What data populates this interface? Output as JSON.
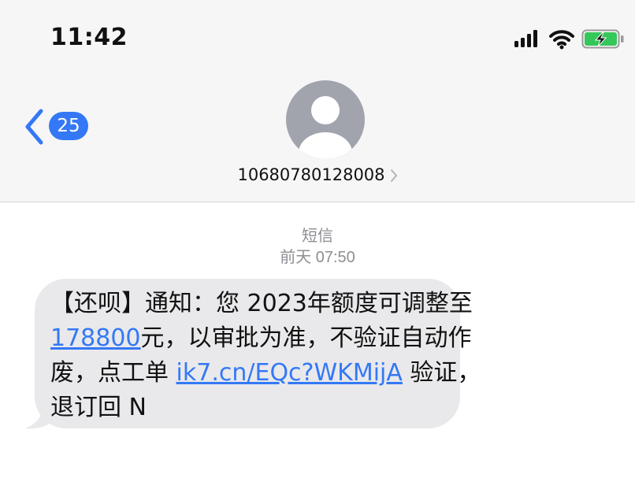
{
  "status_bar": {
    "time": "11:42"
  },
  "nav": {
    "unread_count": "25",
    "contact_name": "10680780128008"
  },
  "thread": {
    "channel_label": "短信",
    "timestamp": "前天 07:50"
  },
  "message": {
    "seg1": "【还呗】通知：您 2023年额度可调整至",
    "amount_link": "178800",
    "seg2": "元，以审批为准，不验证自动作废，点工单 ",
    "url_link": "ik7.cn/EQc?WKMijA",
    "seg3": " 验证，退订回 N"
  },
  "colors": {
    "accent": "#3478f6",
    "bubble": "#e9e9eb",
    "battery": "#34c759"
  },
  "icons": [
    "signal-icon",
    "wifi-icon",
    "battery-charging-icon",
    "back-chevron-icon",
    "contact-avatar-icon",
    "chevron-right-icon"
  ]
}
